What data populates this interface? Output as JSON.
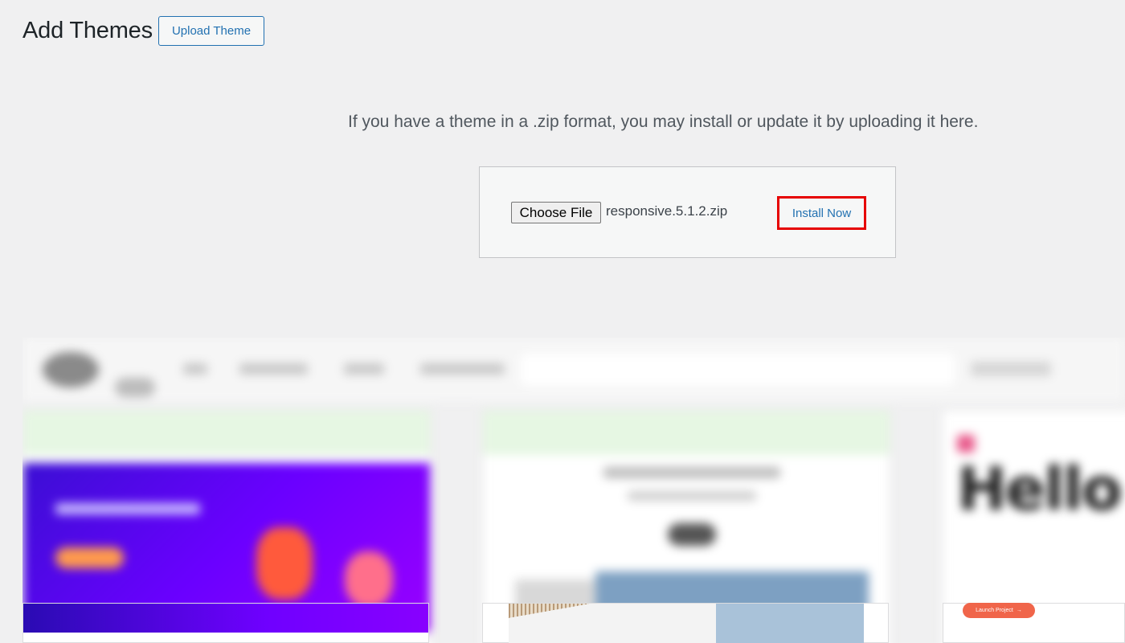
{
  "header": {
    "title": "Add Themes",
    "upload_button_label": "Upload Theme"
  },
  "upload": {
    "help_text": "If you have a theme in a .zip format, you may install or update it by uploading it here.",
    "choose_file_label": "Choose File",
    "selected_file": "responsive.5.1.2.zip",
    "install_button_label": "Install Now",
    "highlight_color": "#e60000"
  },
  "preview": {
    "card3_heading": "Hello",
    "card3_button_label": "Launch Project",
    "card3_button_arrow": "→"
  },
  "colors": {
    "accent": "#2271b1",
    "background": "#f0f0f1"
  }
}
